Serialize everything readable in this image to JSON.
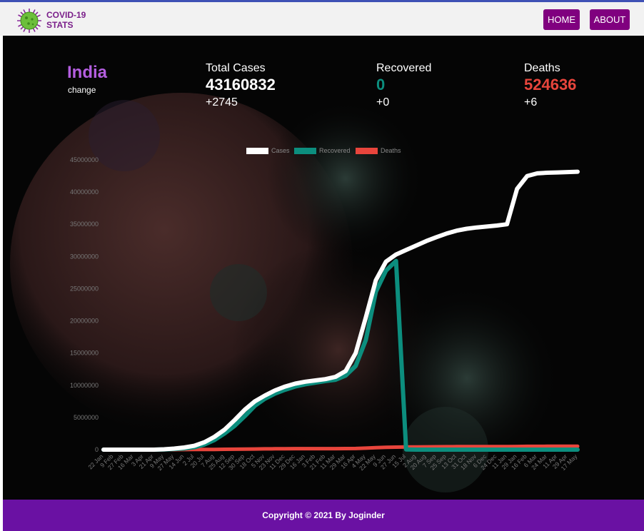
{
  "nav": {
    "brand_line1": "COVID-19",
    "brand_line2": "STATS",
    "home_label": "HOME",
    "about_label": "ABOUT"
  },
  "summary": {
    "country": "India",
    "change_label": "change",
    "total_cases": {
      "label": "Total Cases",
      "value": "43160832",
      "delta": "+2745"
    },
    "recovered": {
      "label": "Recovered",
      "value": "0",
      "delta": "+0"
    },
    "deaths": {
      "label": "Deaths",
      "value": "524636",
      "delta": "+6"
    }
  },
  "colors": {
    "cases": "#ffffff",
    "recovered": "#0c8e7e",
    "deaths": "#e8453c",
    "brand": "#80007f",
    "footer": "#6a11a3"
  },
  "chart_data": {
    "type": "line",
    "legend": [
      "Cases",
      "Recovered",
      "Deaths"
    ],
    "legend_position": "top",
    "ylim": [
      0,
      45000000
    ],
    "yticks": [
      "45000000",
      "40000000",
      "35000000",
      "30000000",
      "25000000",
      "20000000",
      "15000000",
      "10000000",
      "5000000",
      "0"
    ],
    "xticks": [
      "22 Jan",
      "9 Feb",
      "27 Feb",
      "16 Mar",
      "3 Apr",
      "21 Apr",
      "9 May",
      "27 May",
      "14 Jun",
      "2 Jul",
      "20 Jul",
      "7 Aug",
      "25 Aug",
      "12 Sep",
      "30 Sep",
      "18 Oct",
      "5 Nov",
      "23 Nov",
      "11 Dec",
      "29 Dec",
      "16 Jan",
      "3 Feb",
      "21 Feb",
      "11 Mar",
      "29 Mar",
      "16 Apr",
      "4 May",
      "22 May",
      "9 Jun",
      "27 Jun",
      "15 Jul",
      "2 Aug",
      "20 Aug",
      "7 Sep",
      "25 Sep",
      "13 Oct",
      "31 Oct",
      "18 Nov",
      "6 Dec",
      "24 Dec",
      "11 Jan",
      "29 Jan",
      "16 Feb",
      "6 Mar",
      "24 Mar",
      "11 Apr",
      "29 Apr",
      "17 May"
    ],
    "series": [
      {
        "name": "Cases",
        "values": [
          0,
          0,
          0,
          0,
          0,
          0,
          50000,
          170000,
          330000,
          600000,
          1150000,
          2000000,
          3100000,
          4600000,
          6200000,
          7500000,
          8400000,
          9200000,
          9800000,
          10250000,
          10550000,
          10750000,
          10950000,
          11300000,
          12200000,
          15000000,
          20500000,
          26300000,
          29200000,
          30300000,
          31000000,
          31700000,
          32400000,
          33000000,
          33550000,
          34000000,
          34300000,
          34500000,
          34650000,
          34800000,
          35000000,
          40500000,
          42500000,
          42900000,
          43000000,
          43050000,
          43100000,
          43160832
        ]
      },
      {
        "name": "Recovered",
        "values": [
          0,
          0,
          0,
          0,
          0,
          0,
          20000,
          100000,
          180000,
          370000,
          800000,
          1500000,
          2500000,
          3700000,
          5200000,
          6800000,
          7900000,
          8700000,
          9300000,
          9800000,
          10150000,
          10400000,
          10650000,
          10850000,
          11500000,
          13000000,
          17000000,
          24500000,
          27800000,
          29300000,
          30400,
          0,
          0,
          0,
          0,
          0,
          0,
          0,
          0,
          0,
          0,
          0,
          0,
          0,
          0,
          0,
          0,
          0
        ]
      },
      {
        "name": "Deaths",
        "values": [
          0,
          0,
          0,
          0,
          0,
          0,
          2000,
          5000,
          9000,
          17000,
          25000,
          35000,
          50000,
          65000,
          82000,
          100000,
          120000,
          135000,
          145000,
          150000,
          153000,
          155000,
          157000,
          160000,
          165000,
          180000,
          230000,
          300000,
          360000,
          390000,
          410000,
          425000,
          435000,
          445000,
          455000,
          462000,
          466000,
          470000,
          475000,
          479000,
          482000,
          490000,
          508000,
          515000,
          518000,
          520000,
          522000,
          524636
        ]
      }
    ]
  },
  "footer": {
    "text": "Copyright © 2021 By Joginder"
  }
}
